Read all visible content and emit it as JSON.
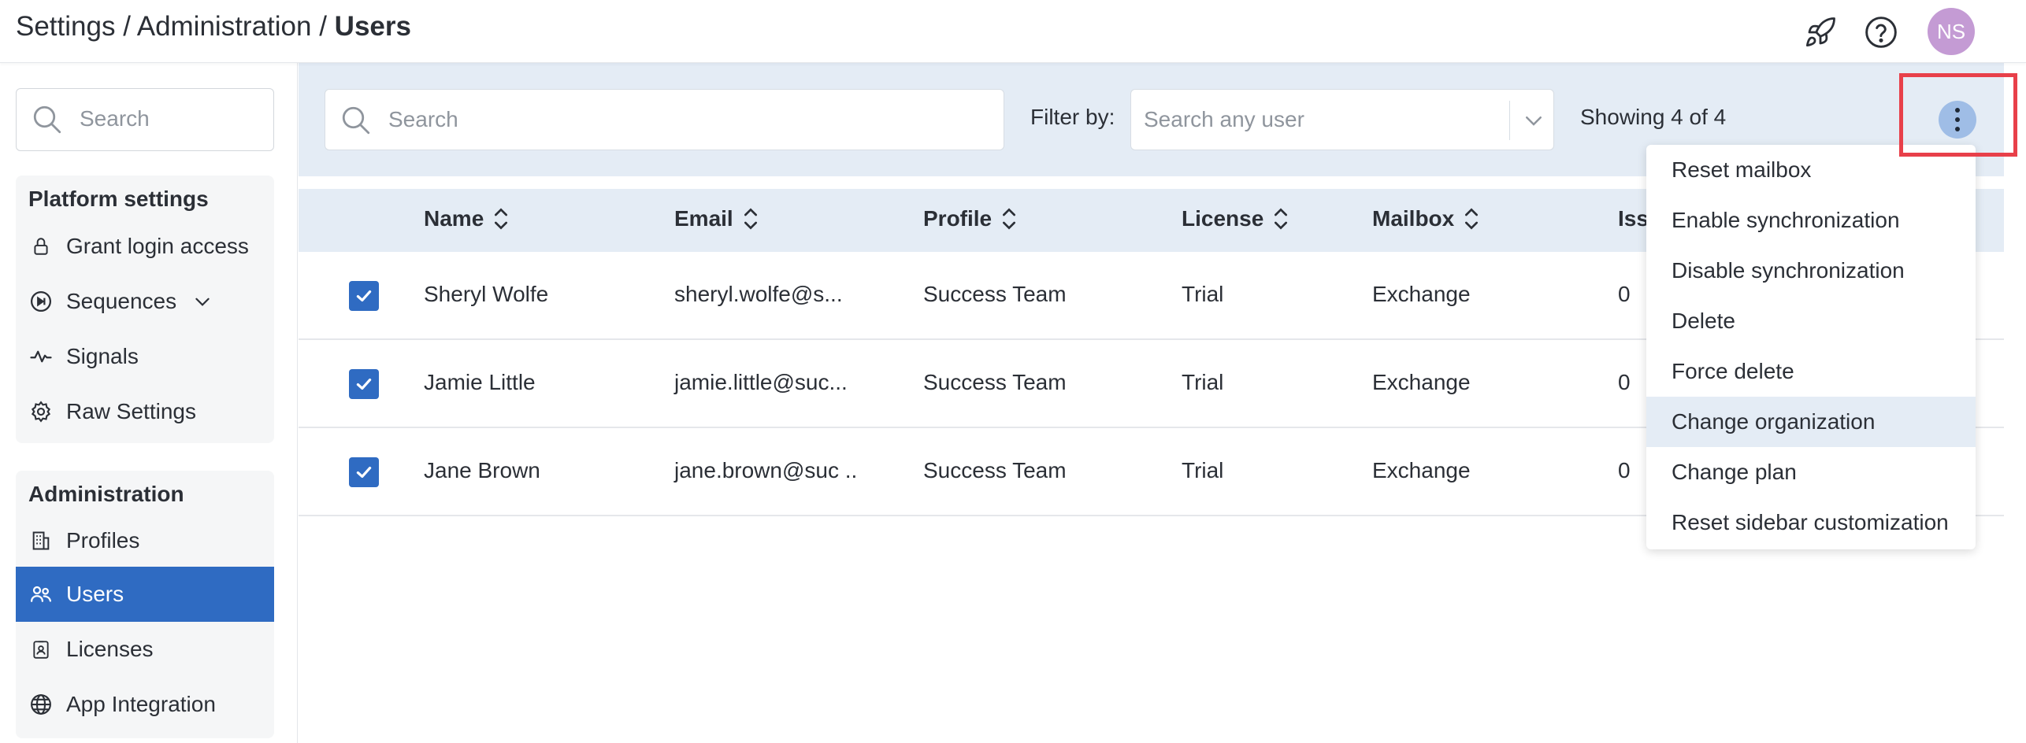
{
  "header": {
    "breadcrumb": {
      "part1": "Settings",
      "sep1": " / ",
      "part2": "Administration",
      "sep2": " / ",
      "current": "Users"
    },
    "icons": [
      "rocket-icon",
      "help-icon"
    ],
    "avatar_initials": "NS",
    "avatar_color": "#c49bd4"
  },
  "sidebar": {
    "search_placeholder": "Search",
    "groups": [
      {
        "title": "Platform settings",
        "items": [
          {
            "label": "Grant login access",
            "icon": "lock-icon"
          },
          {
            "label": "Sequences",
            "icon": "sequences-icon",
            "expandable": true
          },
          {
            "label": "Signals",
            "icon": "signals-icon"
          },
          {
            "label": "Raw Settings",
            "icon": "gear-icon"
          }
        ]
      },
      {
        "title": "Administration",
        "items": [
          {
            "label": "Profiles",
            "icon": "building-icon"
          },
          {
            "label": "Users",
            "icon": "users-icon",
            "active": true
          },
          {
            "label": "Licenses",
            "icon": "badge-icon"
          },
          {
            "label": "App Integration",
            "icon": "globe-icon"
          }
        ]
      }
    ]
  },
  "toolbar": {
    "search_placeholder": "Search",
    "filter_label": "Filter by:",
    "filter_placeholder": "Search any user",
    "showing_text": "Showing 4 of 4"
  },
  "table": {
    "columns": [
      "Name",
      "Email",
      "Profile",
      "License",
      "Mailbox",
      "Iss"
    ],
    "rows": [
      {
        "checked": true,
        "name": "Sheryl Wolfe",
        "email": "sheryl.wolfe@s...",
        "profile": "Success Team",
        "license": "Trial",
        "mailbox": "Exchange",
        "issues": "0"
      },
      {
        "checked": true,
        "name": "Jamie Little",
        "email": "jamie.little@suc...",
        "profile": "Success Team",
        "license": "Trial",
        "mailbox": "Exchange",
        "issues": "0"
      },
      {
        "checked": true,
        "name": "Jane Brown",
        "email": "jane.brown@suc ..",
        "profile": "Success Team",
        "license": "Trial",
        "mailbox": "Exchange",
        "issues": "0"
      }
    ]
  },
  "menu": {
    "items": [
      "Reset mailbox",
      "Enable synchronization",
      "Disable synchronization",
      "Delete",
      "Force delete",
      "Change organization",
      "Change plan",
      "Reset sidebar customization"
    ],
    "hovered_item": "Change organization"
  },
  "colors": {
    "accent": "#2f6bc2",
    "toolbar_bg": "#e4ecf5",
    "highlight_box": "#e8404a"
  }
}
